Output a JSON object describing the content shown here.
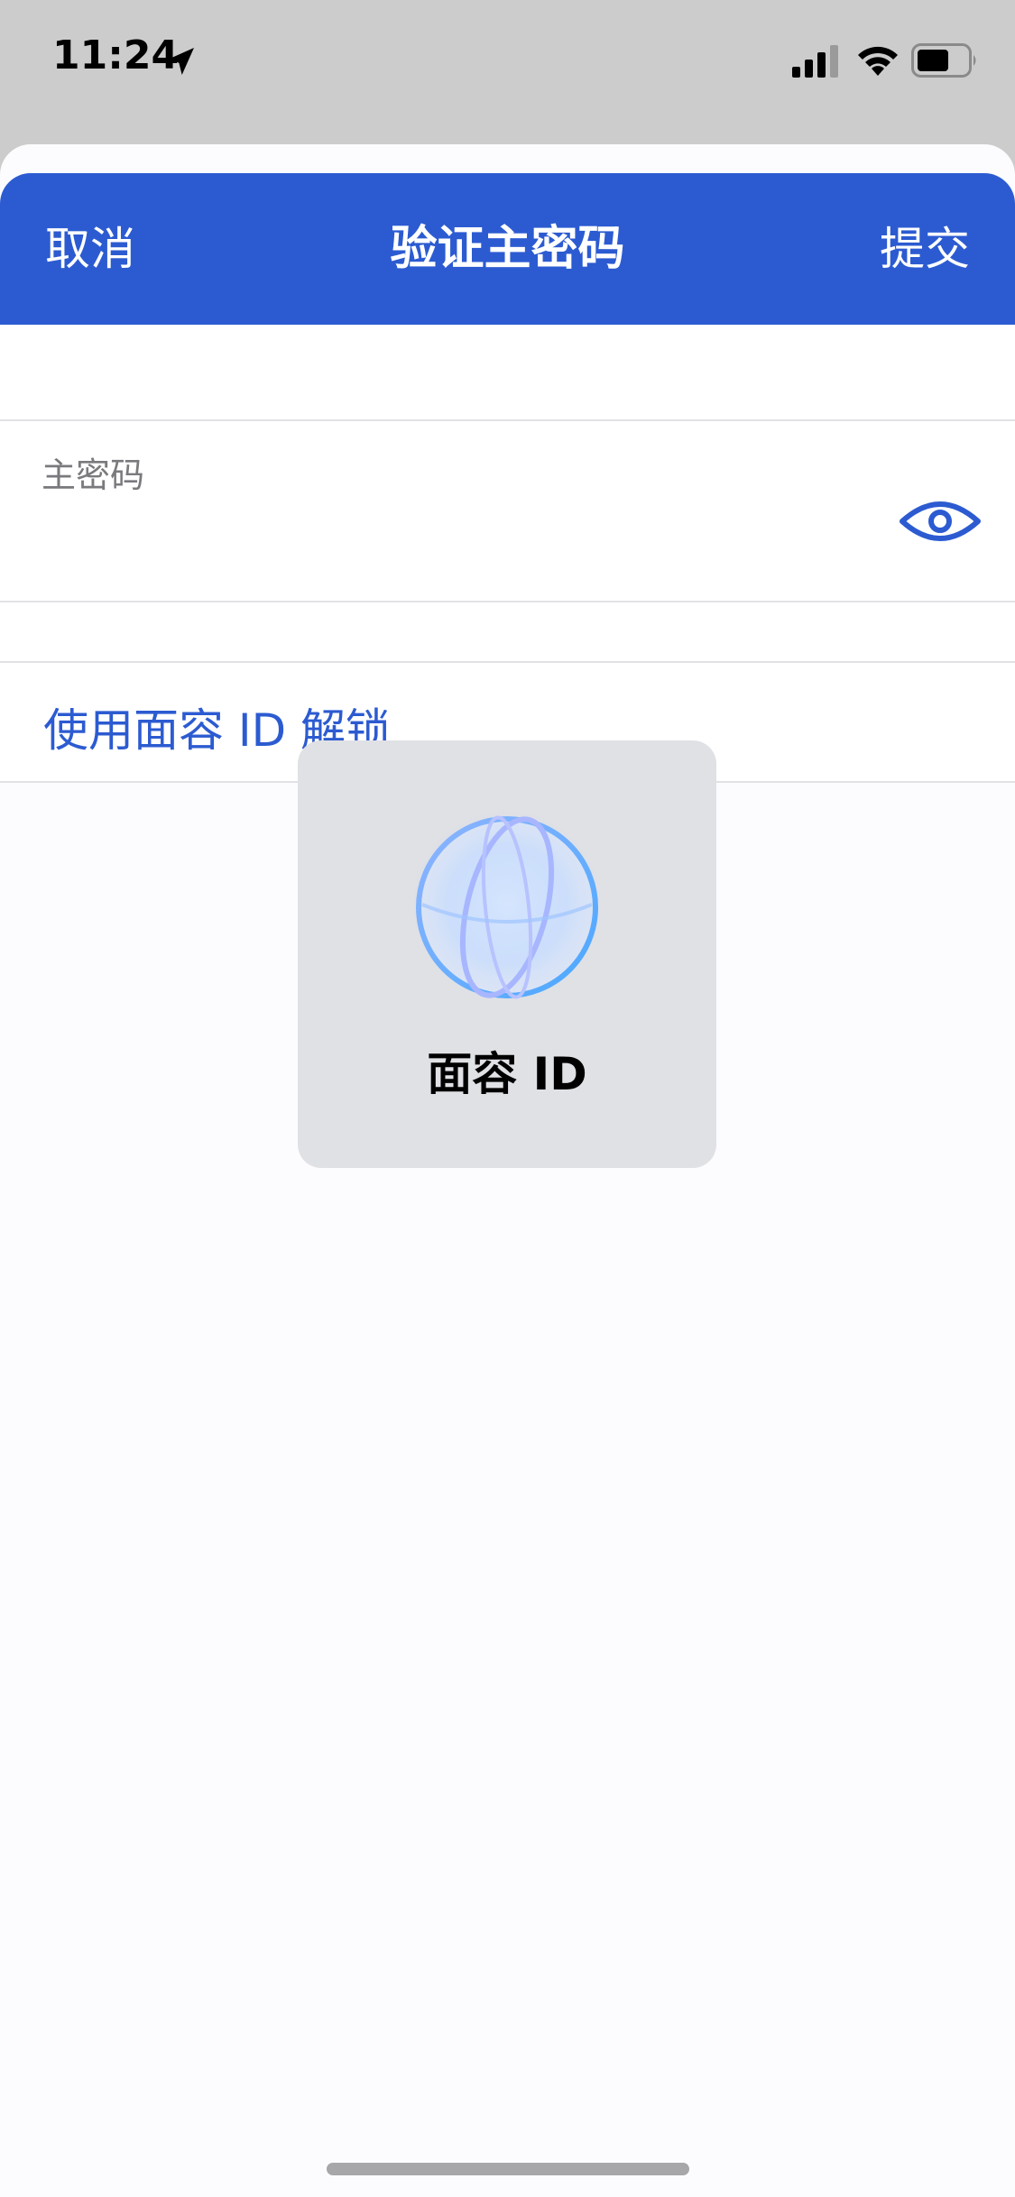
{
  "status_bar": {
    "time": "11:24"
  },
  "nav": {
    "cancel": "取消",
    "title": "验证主密码",
    "submit": "提交"
  },
  "form": {
    "password_label": "主密码",
    "password_value": ""
  },
  "faceid_link": "使用面容 ID 解锁",
  "faceid_popup": {
    "label": "面容 ID"
  },
  "colors": {
    "accent": "#2c5bd1",
    "status_bar_bg": "#cccccc",
    "popup_bg": "#e0e1e5"
  },
  "icons": {
    "location": "location-arrow-icon",
    "signal": "cellular-signal-icon",
    "wifi": "wifi-icon",
    "battery": "battery-icon",
    "eye": "eye-icon",
    "faceid": "faceid-icon"
  }
}
